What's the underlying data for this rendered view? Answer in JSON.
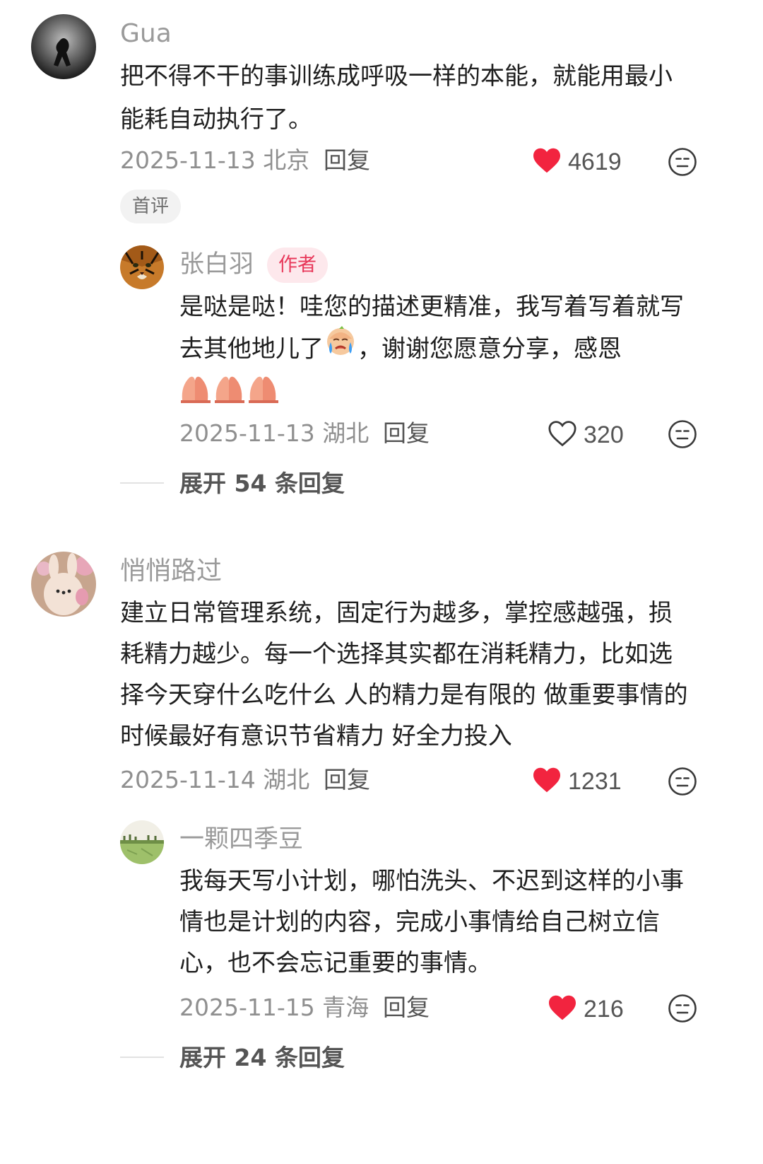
{
  "comments": [
    {
      "username": "Gua",
      "text": "把不得不干的事训练成呼吸一样的本能，就能用最小能耗自动执行了。",
      "date": "2025-11-13",
      "location": "北京",
      "reply_label": "回复",
      "likes": "4619",
      "liked": true,
      "badge": "首评",
      "replies": [
        {
          "username": "张白羽",
          "badge": "作者",
          "text_before_emoji": "是哒是哒！哇您的描述更精准，我写着写着就写去其他地儿了",
          "text_after_emoji": "，谢谢您愿意分享，感恩",
          "date": "2025-11-13",
          "location": "湖北",
          "reply_label": "回复",
          "likes": "320",
          "liked": false
        }
      ],
      "expand_label": "展开 54 条回复"
    },
    {
      "username": "悄悄路过",
      "text": "建立日常管理系统，固定行为越多，掌控感越强，损耗精力越少。每一个选择其实都在消耗精力，比如选择今天穿什么吃什么 人的精力是有限的 做重要事情的时候最好有意识节省精力 好全力投入",
      "date": "2025-11-14",
      "location": "湖北",
      "reply_label": "回复",
      "likes": "1231",
      "liked": true,
      "replies": [
        {
          "username": "一颗四季豆",
          "text": "我每天写小计划，哪怕洗头、不迟到这样的小事情也是计划的内容，完成小事情给自己树立信心，也不会忘记重要的事情。",
          "date": "2025-11-15",
          "location": "青海",
          "reply_label": "回复",
          "likes": "216",
          "liked": true
        }
      ],
      "expand_label": "展开 24 条回复"
    }
  ],
  "colors": {
    "heart_red": "#f2243f",
    "author_badge_text": "#e8385a",
    "author_badge_bg": "#fde8ec",
    "meta_gray": "#8f8f8f"
  },
  "icons": {
    "like": "heart-icon",
    "emoji": "emoji-face-icon",
    "crying": "crying-emoji",
    "praying": "praying-hands-emoji"
  }
}
